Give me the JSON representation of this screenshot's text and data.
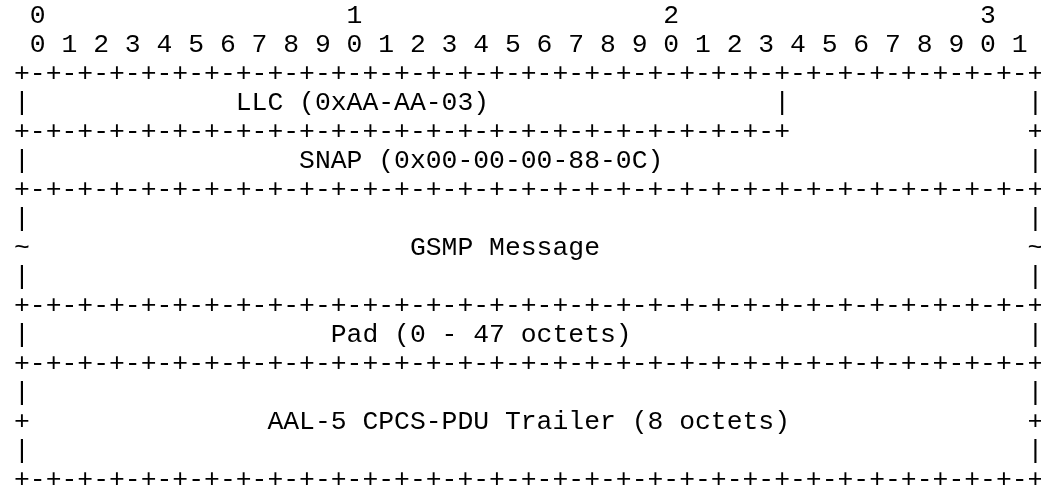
{
  "diagram": {
    "lines": [
      " 0                   1                   2                   3",
      " 0 1 2 3 4 5 6 7 8 9 0 1 2 3 4 5 6 7 8 9 0 1 2 3 4 5 6 7 8 9 0 1",
      "+-+-+-+-+-+-+-+-+-+-+-+-+-+-+-+-+-+-+-+-+-+-+-+-+-+-+-+-+-+-+-+-+",
      "|             LLC (0xAA-AA-03)                  |               |",
      "+-+-+-+-+-+-+-+-+-+-+-+-+-+-+-+-+-+-+-+-+-+-+-+-+               +",
      "|                 SNAP (0x00-00-00-88-0C)                       |",
      "+-+-+-+-+-+-+-+-+-+-+-+-+-+-+-+-+-+-+-+-+-+-+-+-+-+-+-+-+-+-+-+-+",
      "|                                                               |",
      "~                        GSMP Message                           ~",
      "|                                                               |",
      "+-+-+-+-+-+-+-+-+-+-+-+-+-+-+-+-+-+-+-+-+-+-+-+-+-+-+-+-+-+-+-+-+",
      "|                   Pad (0 - 47 octets)                         |",
      "+-+-+-+-+-+-+-+-+-+-+-+-+-+-+-+-+-+-+-+-+-+-+-+-+-+-+-+-+-+-+-+-+",
      "|                                                               |",
      "+               AAL-5 CPCS-PDU Trailer (8 octets)               +",
      "|                                                               |",
      "+-+-+-+-+-+-+-+-+-+-+-+-+-+-+-+-+-+-+-+-+-+-+-+-+-+-+-+-+-+-+-+-+"
    ]
  }
}
